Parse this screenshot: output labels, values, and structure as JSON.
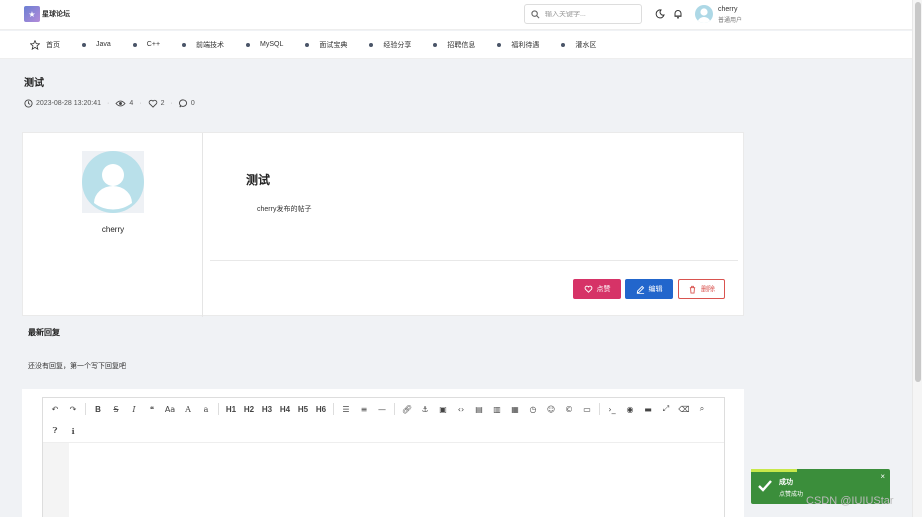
{
  "header": {
    "logo_mark": "★",
    "logo_text": "星球论坛",
    "search_placeholder": "输入关键字...",
    "user_name": "cherry",
    "user_role": "普通用户"
  },
  "nav": {
    "items": [
      {
        "label": "首页",
        "icon": "star-icon"
      },
      {
        "label": "Java"
      },
      {
        "label": "C++"
      },
      {
        "label": "前端技术"
      },
      {
        "label": "MySQL"
      },
      {
        "label": "面试宝典"
      },
      {
        "label": "经验分享"
      },
      {
        "label": "招聘信息"
      },
      {
        "label": "福利待遇"
      },
      {
        "label": "灌水区"
      }
    ]
  },
  "post": {
    "title": "测试",
    "datetime": "2023-08-28 13:20:41",
    "views": "4",
    "likes": "2",
    "comments": "0",
    "author": "cherry",
    "card_title": "测试",
    "body": "cherry发布的帖子",
    "like_label": "点赞",
    "edit_label": "编辑",
    "delete_label": "删除",
    "colors": {
      "like": "#d63367",
      "edit": "#2266cc",
      "delete": "#d9534f"
    }
  },
  "replies": {
    "heading": "最新回复",
    "empty_text": "还没有回复，第一个写下回复吧"
  },
  "editor": {
    "headings": [
      "H1",
      "H2",
      "H3",
      "H4",
      "H5",
      "H6"
    ],
    "font_label": "Aa",
    "font2_label": "A",
    "font3_label": "a"
  },
  "toast": {
    "title": "成功",
    "message": "点赞成功",
    "color": "#3b8e3b"
  },
  "watermark": "CSDN @IUIUStar"
}
